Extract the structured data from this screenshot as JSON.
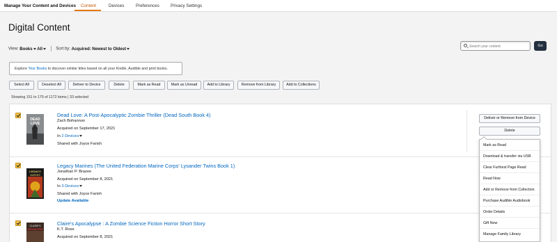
{
  "nav": {
    "brand": "Manage Your Content and Devices",
    "tabs": [
      "Content",
      "Devices",
      "Preferences",
      "Privacy Settings"
    ]
  },
  "page_title": "Digital Content",
  "view": {
    "view_label": "View:",
    "view_value": "Books",
    "filter_value": "All",
    "sort_label": "Sort by:",
    "sort_value": "Acquired: Newest to Oldest"
  },
  "search": {
    "placeholder": "Search your content",
    "go_label": "Go"
  },
  "info": {
    "prefix": "Explore ",
    "link": "Your Books",
    "suffix": " to discover similar titles based on all your Kindle, Audible and print books."
  },
  "toolbar": [
    "Select All",
    "Deselect All",
    "Deliver to Device",
    "Delete",
    "Mark as Read",
    "Mark as Unread",
    "Add to Library",
    "Remove from Library",
    "Add to Collections"
  ],
  "showing": "Showing 151 to 175 of 1172 items  | 33 selected",
  "items": [
    {
      "title": "Dead Love: A Post-Apocalyptic Zombie Thriller (Dead South Book 4)",
      "author": "Zach Bohannon",
      "acquired": "Acquired on September 17, 2021",
      "in_prefix": "In ",
      "devices": "2 Devices",
      "shared": "Shared with Joyce Farish",
      "cover_text": "DEAD LOVE"
    },
    {
      "title": "Legacy Marines (The United Federation Marine Corps' Lysander Twins Book 1)",
      "author": "Jonathan P. Brazee",
      "acquired": "Acquired on September 8, 2021",
      "in_prefix": "In ",
      "devices": "3 Devices",
      "shared": "Shared with Joyce Farish",
      "update": "Update Available",
      "cover_text": "LEGACY MARINES"
    },
    {
      "title": "Claire's Apocalypse : A Zombie Science Fiction Horror Short Story",
      "author": "K.T. Rose",
      "acquired": "Acquired on September 8, 2021",
      "cover_text": "CLAIRE'S APOCALYPSE"
    }
  ],
  "actions": {
    "deliver_remove": "Deliver or Remove from Device",
    "delete": "Delete"
  },
  "dropdown": [
    "Mark as Read",
    "Download & transfer via USB",
    "Clear Furthest Page Read",
    "Read Now",
    "Add or Remove from Collection",
    "Purchase Audible Audiobook",
    "Order Details",
    "Gift Now",
    "Manage Family Library"
  ],
  "colors": {
    "accent": "#e47911",
    "link": "#0066c0",
    "checkbox": "#f0c14b",
    "go_button": "#232f3e"
  }
}
